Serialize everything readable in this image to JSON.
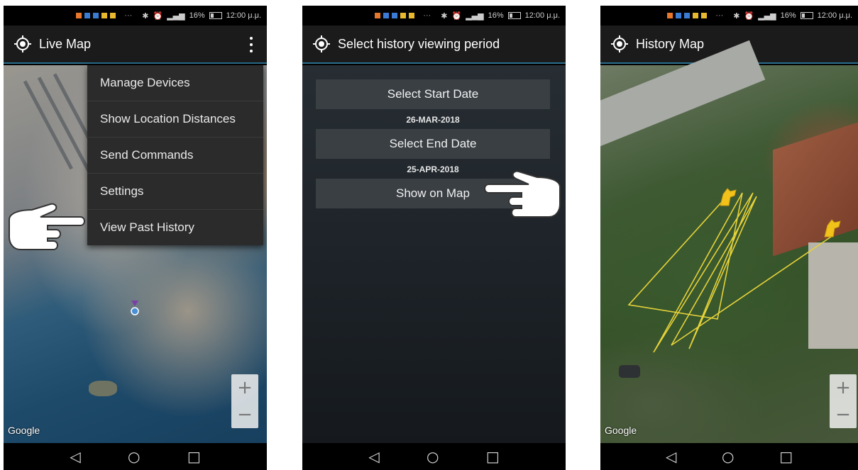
{
  "status_bar": {
    "battery": "16%",
    "time": "12:00 μ.μ."
  },
  "screens": [
    {
      "title": "Live Map",
      "menu_items": [
        "Manage Devices",
        "Show Location Distances",
        "Send Commands",
        "Settings",
        "View Past History"
      ],
      "map_attribution": "Google",
      "zoom_in": "+",
      "zoom_out": "−"
    },
    {
      "title": "Select history viewing period",
      "start_button": "Select Start Date",
      "start_date": "26-MAR-2018",
      "end_button": "Select End Date",
      "end_date": "25-APR-2018",
      "show_button": "Show on Map"
    },
    {
      "title": "History Map",
      "map_attribution": "Google",
      "zoom_in": "+",
      "zoom_out": "−"
    }
  ],
  "nav": {
    "back": "◁",
    "home": "○",
    "recents": "□"
  },
  "colors": {
    "accent_line": "#2a6f8e",
    "track": "#e6d23a",
    "marker_dog": "#f2c21b",
    "menu_bg": "#2b2b2b"
  },
  "icons": [
    "location-crosshair-icon",
    "overflow-menu-icon",
    "pointing-hand-icon",
    "dog-marker-icon"
  ]
}
